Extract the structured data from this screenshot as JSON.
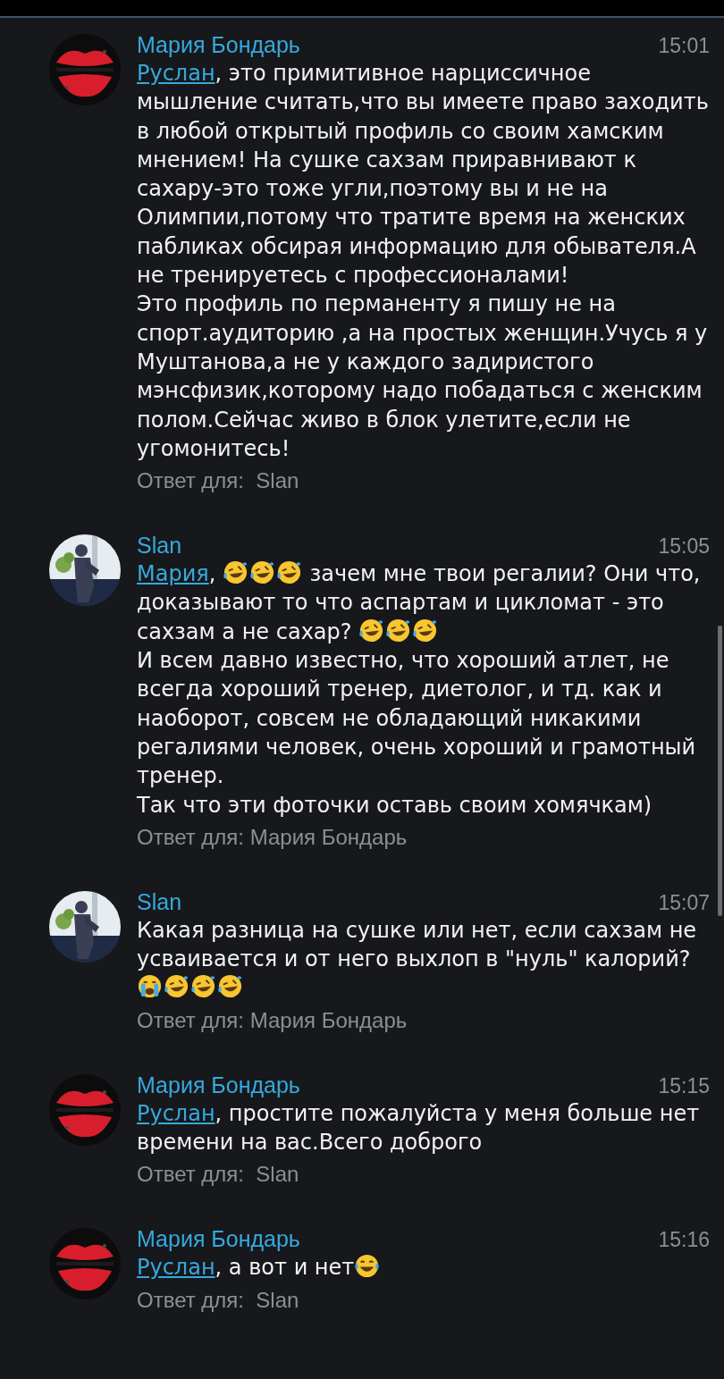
{
  "comments": [
    {
      "author": "Мария Бондарь",
      "time": "15:01",
      "avatar": {
        "kind": "picture",
        "color": "#d81e2c"
      },
      "body": [
        [
          {
            "kind": "mention",
            "text": "Руслан"
          },
          {
            "kind": "text",
            "text": ", это примитивное нарциссичное мышление считать,что вы имеете право заходить в любой открытый профиль со своим хамским мнением! На сушке сахзам приравнивают к сахару-это тоже угли,поэтому вы и не на Олимпии,потому что тратите время на женских пабликах обсирая информацию для обывателя.А не тренируетесь с профессионалами!"
          }
        ],
        [
          {
            "kind": "text",
            "text": "Это профиль по перманенту я пишу не на спорт.аудиторию ,а на простых женщин.Учусь я у Муштанова,а не у каждого задиристого мэнсфизик,которому надо побадаться с женским полом.Сейчас живо в блок улетите,если не угомонитесь!"
          }
        ]
      ],
      "reply": "Ответ для:  Slan"
    },
    {
      "author": "Slan",
      "time": "15:05",
      "avatar": {
        "kind": "picture",
        "color": "#e6ecf0"
      },
      "body": [
        [
          {
            "kind": "mention",
            "text": "Мария"
          },
          {
            "kind": "text",
            "text": ", "
          },
          {
            "kind": "laugh"
          },
          {
            "kind": "laugh"
          },
          {
            "kind": "laugh"
          },
          {
            "kind": "text",
            "text": " зачем мне твои регалии? Они что, доказывают то что аспартам и цикломат - это сахзам а не сахар? "
          },
          {
            "kind": "laugh"
          },
          {
            "kind": "laugh"
          },
          {
            "kind": "laugh"
          }
        ],
        [
          {
            "kind": "text",
            "text": "И всем давно известно, что хороший атлет, не всегда хороший тренер, диетолог, и тд. как и наоборот, совсем не обладающий никакими регалиями человек, очень хороший и грамотный тренер."
          }
        ],
        [
          {
            "kind": "text",
            "text": "Так что эти фоточки оставь своим хомячкам)"
          }
        ]
      ],
      "reply": "Ответ для: Мария Бондарь"
    },
    {
      "author": "Slan",
      "time": "15:07",
      "avatar": {
        "kind": "picture",
        "color": "#e6ecf0"
      },
      "body": [
        [
          {
            "kind": "text",
            "text": "Какая разница на сушке или нет, если сахзам не усваивается и от него выхлоп в \"нуль\" калорий?"
          }
        ],
        [
          {
            "kind": "cry"
          },
          {
            "kind": "laugh"
          },
          {
            "kind": "laugh"
          },
          {
            "kind": "laugh"
          }
        ]
      ],
      "reply": "Ответ для: Мария Бондарь"
    },
    {
      "author": "Мария Бондарь",
      "time": "15:15",
      "avatar": {
        "kind": "picture",
        "color": "#d81e2c"
      },
      "body": [
        [
          {
            "kind": "mention",
            "text": "Руслан"
          },
          {
            "kind": "text",
            "text": ", простите пожалуйста у меня больше нет времени на вас.Всего доброго"
          }
        ]
      ],
      "reply": "Ответ для:  Slan"
    },
    {
      "author": "Мария Бондарь",
      "time": "15:16",
      "avatar": {
        "kind": "picture",
        "color": "#d81e2c"
      },
      "body": [
        [
          {
            "kind": "mention",
            "text": "Руслан"
          },
          {
            "kind": "text",
            "text": ", а вот и нет"
          },
          {
            "kind": "joy"
          }
        ]
      ],
      "reply": "Ответ для:  Slan"
    }
  ]
}
